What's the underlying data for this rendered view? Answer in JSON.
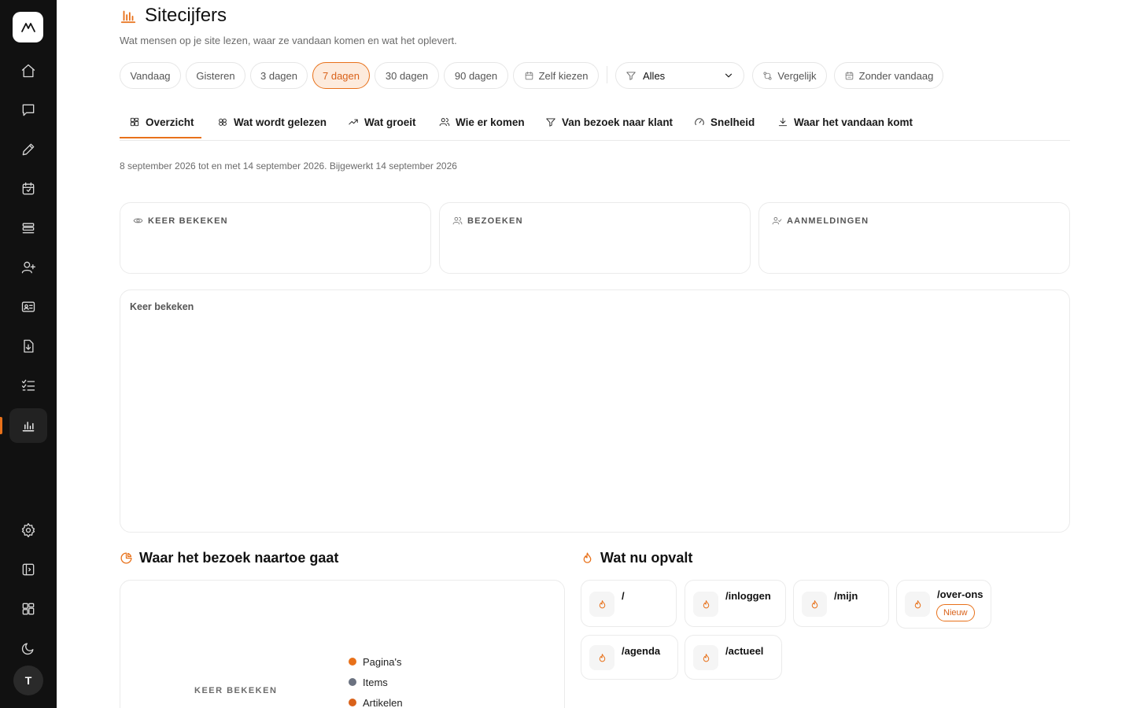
{
  "sidebar": {
    "items": [
      {
        "icon": "home-icon"
      },
      {
        "icon": "chat-icon"
      },
      {
        "icon": "pencil-icon"
      },
      {
        "icon": "calendar-icon"
      },
      {
        "icon": "list-icon"
      },
      {
        "icon": "user-plus-icon"
      },
      {
        "icon": "contact-card-icon"
      },
      {
        "icon": "file-download-icon"
      },
      {
        "icon": "checklist-icon"
      },
      {
        "icon": "bar-chart-icon",
        "active": true
      },
      {
        "icon": "settings-icon"
      },
      {
        "icon": "panel-toggle-icon"
      },
      {
        "icon": "grid-icon"
      },
      {
        "icon": "moon-icon"
      }
    ],
    "avatar_initial": "T"
  },
  "header": {
    "title": "Sitecijfers",
    "subtitle": "Wat mensen op je site lezen, waar ze vandaan komen en wat het oplevert."
  },
  "filters": {
    "ranges": [
      "Vandaag",
      "Gisteren",
      "3 dagen",
      "7 dagen",
      "30 dagen",
      "90 dagen"
    ],
    "active_range": "7 dagen",
    "custom": "Zelf kiezen",
    "segment_value": "Alles",
    "compare": "Vergelijk",
    "exclude_today": "Zonder vandaag"
  },
  "tabs": [
    {
      "label": "Overzicht",
      "icon": "layout-grid-icon",
      "active": true
    },
    {
      "label": "Wat wordt gelezen",
      "icon": "cluster-icon"
    },
    {
      "label": "Wat groeit",
      "icon": "trending-up-icon"
    },
    {
      "label": "Wie er komen",
      "icon": "users-icon"
    },
    {
      "label": "Van bezoek naar klant",
      "icon": "funnel-icon"
    },
    {
      "label": "Snelheid",
      "icon": "gauge-icon"
    },
    {
      "label": "Waar het vandaan komt",
      "icon": "download-icon"
    }
  ],
  "range_text": "8 september 2026 tot en met 14 september 2026. Bijgewerkt 14 september 2026",
  "stats": [
    {
      "label": "KEER BEKEKEN",
      "icon": "eye-icon"
    },
    {
      "label": "BEZOEKEN",
      "icon": "users-icon"
    },
    {
      "label": "AANMELDINGEN",
      "icon": "user-check-icon"
    }
  ],
  "chart": {
    "title": "Keer bekeken"
  },
  "destinations": {
    "heading": "Waar het bezoek naartoe gaat",
    "center_label": "KEER BEKEKEN",
    "legend": [
      {
        "label": "Pagina's",
        "color": "#e8711a"
      },
      {
        "label": "Items",
        "color": "#6b7280"
      },
      {
        "label": "Artikelen",
        "color": "#d9621a"
      }
    ]
  },
  "trending": {
    "heading": "Wat nu opvalt",
    "items": [
      {
        "path": "/"
      },
      {
        "path": "/inloggen"
      },
      {
        "path": "/mijn"
      },
      {
        "path": "/over-ons",
        "badge": "Nieuw"
      },
      {
        "path": "/agenda"
      },
      {
        "path": "/actueel"
      }
    ]
  },
  "colors": {
    "accent": "#e8711a",
    "sidebar_bg": "#111111"
  }
}
